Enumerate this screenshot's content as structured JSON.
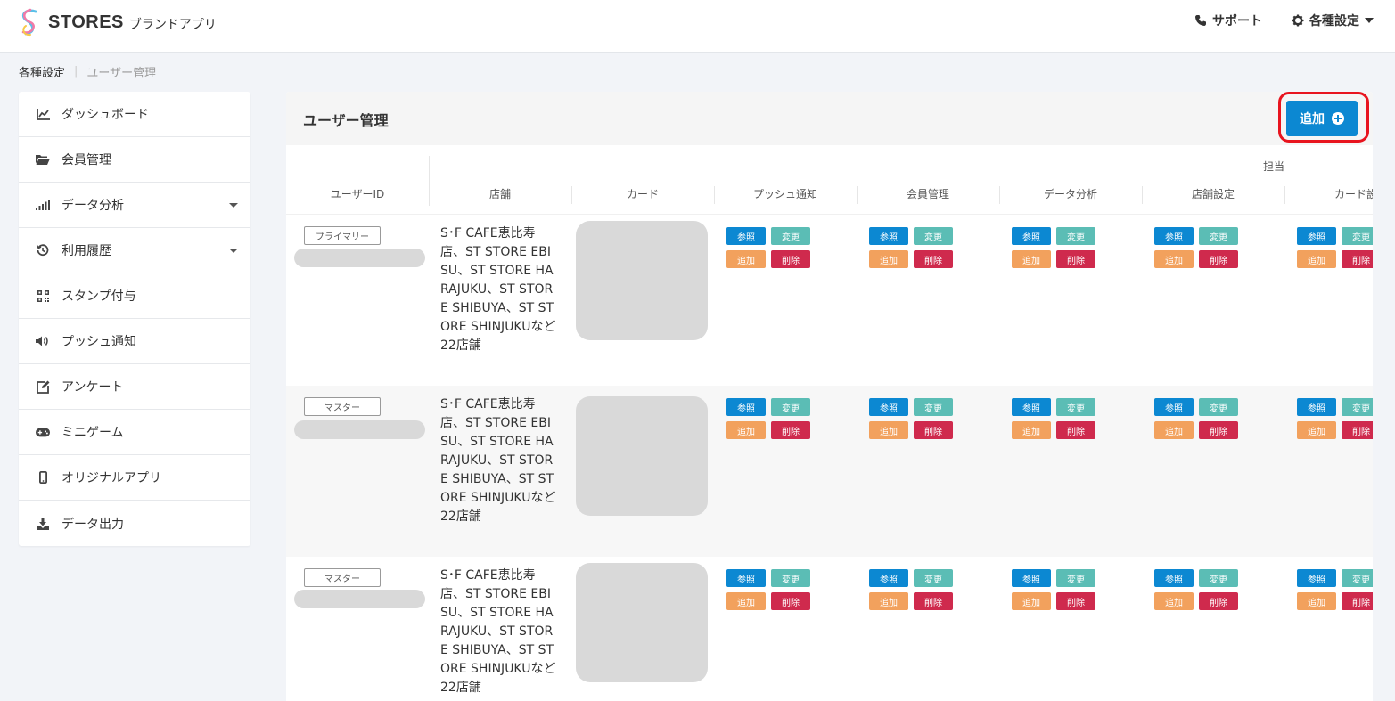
{
  "header": {
    "logo_text": "STORES",
    "logo_sub": "ブランドアプリ",
    "support_label": "サポート",
    "settings_label": "各種設定"
  },
  "breadcrumb": {
    "root": "各種設定",
    "separator": "|",
    "current": "ユーザー管理"
  },
  "sidebar": {
    "items": [
      {
        "label": "ダッシュボード",
        "icon": "line-chart-icon"
      },
      {
        "label": "会員管理",
        "icon": "folder-open-icon"
      },
      {
        "label": "データ分析",
        "icon": "signal-bars-icon",
        "has_caret": true
      },
      {
        "label": "利用履歴",
        "icon": "history-icon",
        "has_caret": true
      },
      {
        "label": "スタンプ付与",
        "icon": "qrcode-icon"
      },
      {
        "label": "プッシュ通知",
        "icon": "volume-icon"
      },
      {
        "label": "アンケート",
        "icon": "edit-icon"
      },
      {
        "label": "ミニゲーム",
        "icon": "gamepad-icon"
      },
      {
        "label": "オリジナルアプリ",
        "icon": "mobile-icon"
      },
      {
        "label": "データ出力",
        "icon": "download-icon"
      }
    ]
  },
  "panel": {
    "title": "ユーザー管理",
    "add_button": "追加"
  },
  "table": {
    "group_header": "担当",
    "columns": [
      "ユーザーID",
      "店舗",
      "カード",
      "プッシュ通知",
      "会員管理",
      "データ分析",
      "店舗設定",
      "カード設"
    ],
    "permission_labels": {
      "view": "参照",
      "edit": "変更",
      "add": "追加",
      "delete": "削除"
    },
    "rows": [
      {
        "role": "プライマリー",
        "stores": "S･F CAFE恵比寿店、ST STORE EBISU、ST STORE HARAJUKU、ST STORE SHIBUYA、ST STORE SHINJUKUなど22店舗"
      },
      {
        "role": "マスター",
        "stores": "S･F CAFE恵比寿店、ST STORE EBISU、ST STORE HARAJUKU、ST STORE SHIBUYA、ST STORE SHINJUKUなど22店舗"
      },
      {
        "role": "マスター",
        "stores": "S･F CAFE恵比寿店、ST STORE EBISU、ST STORE HARAJUKU、ST STORE SHIBUYA、ST STORE SHINJUKUなど22店舗"
      }
    ]
  },
  "colors": {
    "accent": "#0c88d2",
    "edit": "#5bbdb5",
    "add": "#f2a15d",
    "delete": "#cf2a4d",
    "highlight": "#e8141e"
  }
}
